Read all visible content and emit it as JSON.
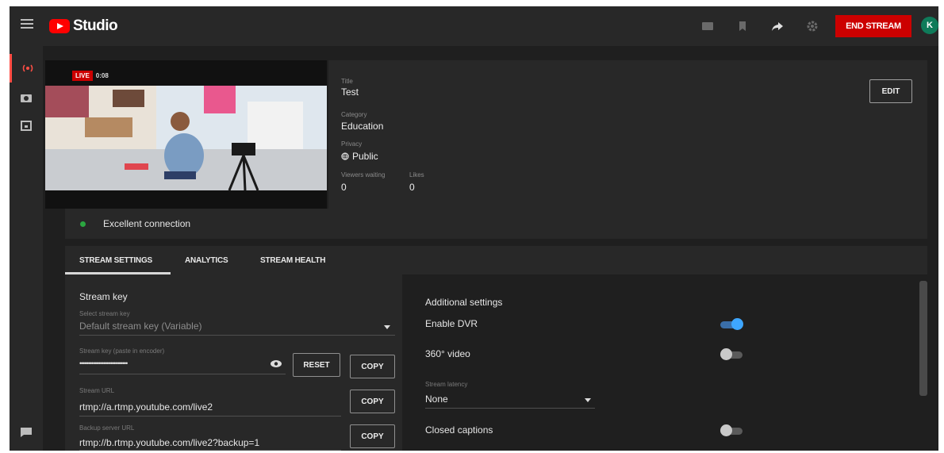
{
  "app": {
    "logo_text": "Studio",
    "end_stream_label": "END STREAM",
    "avatar_initial": "K"
  },
  "preview": {
    "live_tag": "LIVE",
    "live_time": "0:08"
  },
  "info": {
    "title_label": "Title",
    "title_value": "Test",
    "category_label": "Category",
    "category_value": "Education",
    "privacy_label": "Privacy",
    "privacy_value": "Public",
    "viewers_label": "Viewers waiting",
    "viewers_value": "0",
    "likes_label": "Likes",
    "likes_value": "0",
    "edit_label": "EDIT"
  },
  "connection": {
    "status_text": "Excellent connection",
    "status_color": "#2ba640"
  },
  "tabs": [
    {
      "label": "STREAM SETTINGS",
      "active": true
    },
    {
      "label": "ANALYTICS",
      "active": false
    },
    {
      "label": "STREAM HEALTH",
      "active": false
    }
  ],
  "stream_key": {
    "section_title": "Stream key",
    "select_label": "Select stream key",
    "select_value": "Default stream key (Variable)",
    "key_label": "Stream key (paste in encoder)",
    "key_value": "••••••••••••••••••••••••••••",
    "reset_label": "RESET",
    "copy_label": "COPY",
    "url_label": "Stream URL",
    "url_value": "rtmp://a.rtmp.youtube.com/live2",
    "backup_label": "Backup server URL",
    "backup_value": "rtmp://b.rtmp.youtube.com/live2?backup=1"
  },
  "additional": {
    "section_title": "Additional settings",
    "dvr_label": "Enable DVR",
    "dvr_on": true,
    "video360_label": "360° video",
    "video360_on": false,
    "latency_label": "Stream latency",
    "latency_value": "None",
    "captions_label": "Closed captions",
    "captions_on": false
  },
  "colors": {
    "accent_red": "#cc0000",
    "toggle_blue": "#3ea6ff",
    "background": "#1f1f1f",
    "card": "#282828"
  }
}
